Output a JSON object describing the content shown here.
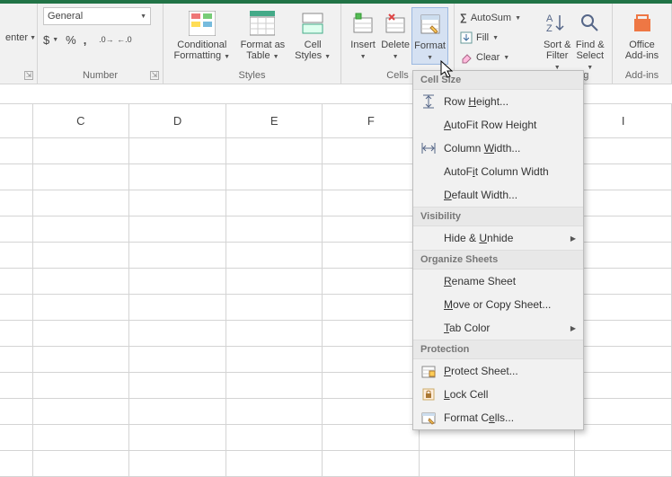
{
  "ribbon": {
    "alignment": {
      "center_label": "enter",
      "group": ""
    },
    "number": {
      "format_selected": "General",
      "accounting": "$",
      "percent": "%",
      "comma": ",",
      "group": "Number"
    },
    "styles": {
      "conditional": "Conditional Formatting",
      "format_table": "Format as Table",
      "cell_styles": "Cell Styles",
      "group": "Styles"
    },
    "cells": {
      "insert": "Insert",
      "delete": "Delete",
      "format": "Format",
      "group": "Cells"
    },
    "editing": {
      "autosum": "AutoSum",
      "fill": "Fill",
      "clear": "Clear",
      "sort_filter": "Sort & Filter",
      "find_select": "Find & Select",
      "group": "Editing"
    },
    "addins": {
      "office": "Office Add-ins",
      "group": "Add-ins"
    }
  },
  "columns": [
    "C",
    "D",
    "E",
    "F",
    "",
    "",
    "I"
  ],
  "format_menu": {
    "sections": {
      "cell_size": "Cell Size",
      "visibility": "Visibility",
      "organize": "Organize Sheets",
      "protection": "Protection"
    },
    "items": {
      "row_height": "Row Height...",
      "autofit_row": "AutoFit Row Height",
      "col_width": "Column Width...",
      "autofit_col": "AutoFit Column Width",
      "default_width": "Default Width...",
      "hide_unhide": "Hide & Unhide",
      "rename": "Rename Sheet",
      "move_copy": "Move or Copy Sheet...",
      "tab_color": "Tab Color",
      "protect": "Protect Sheet...",
      "lock": "Lock Cell",
      "format_cells": "Format Cells..."
    }
  }
}
